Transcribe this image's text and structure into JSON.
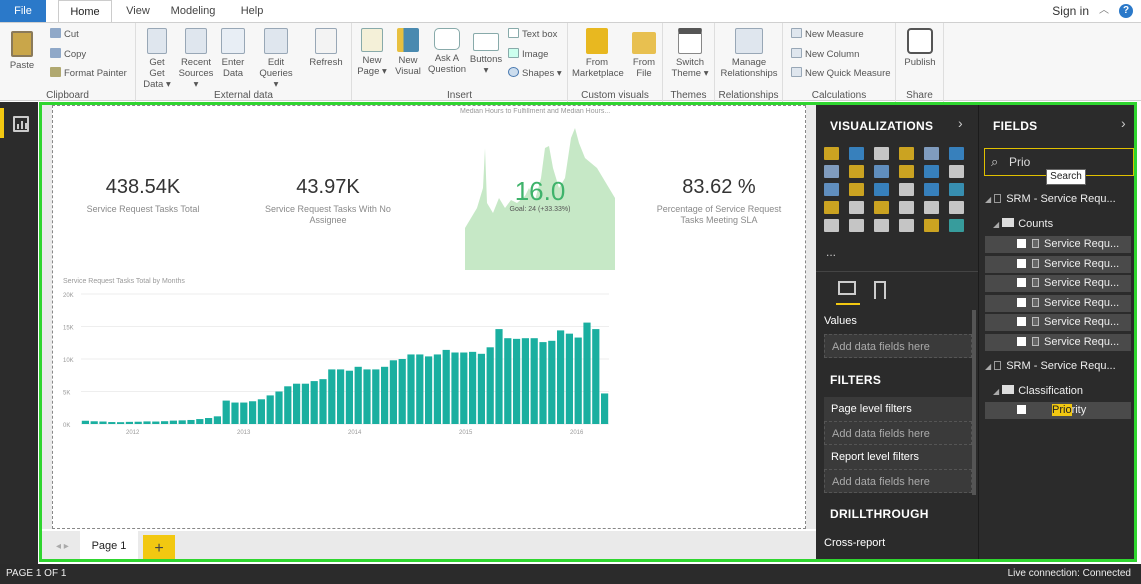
{
  "menubar": {
    "file": "File",
    "tabs": [
      "Home",
      "View",
      "Modeling",
      "Help"
    ],
    "signin": "Sign in",
    "help": "?"
  },
  "ribbon": {
    "clipboard": {
      "label": "Clipboard",
      "paste": "Paste",
      "cut": "Cut",
      "copy": "Copy",
      "format_painter": "Format Painter"
    },
    "external": {
      "label": "External data",
      "get_data": "Get Data ▾",
      "get_data_1": "Get",
      "recent_1": "Recent",
      "recent_2": "Sources ▾",
      "enter_1": "Enter",
      "enter_2": "Data",
      "edit_1": "Edit",
      "edit_2": "Queries ▾",
      "refresh": "Refresh"
    },
    "insert": {
      "label": "Insert",
      "new_page_1": "New",
      "new_page_2": "Page ▾",
      "new_visual_1": "New",
      "new_visual_2": "Visual",
      "ask_1": "Ask A",
      "ask_2": "Question",
      "buttons_1": "Buttons",
      "buttons_2": "▾",
      "text_box": "Text box",
      "image": "Image",
      "shapes": "Shapes ▾"
    },
    "custom_visuals": {
      "label": "Custom visuals",
      "from_marketplace_1": "From",
      "from_marketplace_2": "Marketplace",
      "from_file_1": "From",
      "from_file_2": "File"
    },
    "themes": {
      "label": "Themes",
      "switch_1": "Switch",
      "switch_2": "Theme ▾"
    },
    "relationships": {
      "label": "Relationships",
      "manage_1": "Manage",
      "manage_2": "Relationships"
    },
    "calculations": {
      "label": "Calculations",
      "new_measure": "New Measure",
      "new_column": "New Column",
      "new_quick_measure": "New Quick Measure"
    },
    "share": {
      "label": "Share",
      "publish": "Publish"
    }
  },
  "report": {
    "kpis": [
      {
        "value": "438.54K",
        "label": "Service Request Tasks Total"
      },
      {
        "value": "43.97K",
        "label": "Service Request Tasks With No Assignee"
      },
      {
        "value": "83.62 %",
        "label": "Percentage of Service Request Tasks Meeting SLA"
      }
    ],
    "gauge": {
      "title": "Median Hours to Fulfillment and Median Hours...",
      "value": "16.0",
      "goal": "Goal: 24 (+33.33%)"
    },
    "bar_chart_title": "Service Request Tasks Total by Months"
  },
  "chart_data": {
    "type": "bar",
    "title": "Service Request Tasks Total by Months",
    "xlabel": "",
    "ylabel": "",
    "ylim": [
      0,
      20000
    ],
    "yticks": [
      "20K",
      "15K",
      "10K",
      "5K",
      "0K"
    ],
    "xticks": [
      "2012",
      "2013",
      "2014",
      "2015",
      "2016"
    ],
    "color": "#1aafa0",
    "values": [
      500,
      420,
      380,
      300,
      280,
      330,
      350,
      400,
      380,
      430,
      520,
      560,
      620,
      760,
      920,
      1180,
      3600,
      3300,
      3300,
      3500,
      3800,
      4400,
      5000,
      5800,
      6200,
      6200,
      6600,
      6900,
      8400,
      8400,
      8200,
      8800,
      8400,
      8400,
      8800,
      9800,
      10000,
      10700,
      10700,
      10400,
      10700,
      11400,
      11000,
      11000,
      11100,
      10800,
      11800,
      14600,
      13200,
      13100,
      13200,
      13200,
      12600,
      12800,
      14400,
      13900,
      13300,
      15600,
      14600,
      4700
    ]
  },
  "pagetabs": {
    "page1": "Page 1",
    "add": "+"
  },
  "visualizations": {
    "title": "VISUALIZATIONS",
    "more": "...",
    "values_label": "Values",
    "values_well": "Add data fields here",
    "filters_title": "FILTERS",
    "page_level": "Page level filters",
    "page_well": "Add data fields here",
    "report_level": "Report level filters",
    "report_well": "Add data fields here",
    "drillthrough_title": "DRILLTHROUGH",
    "cross_report": "Cross-report"
  },
  "fields": {
    "title": "FIELDS",
    "search_value": "Prio",
    "search_tooltip": "Search",
    "table1": "SRM - Service Requ...",
    "folder1": "Counts",
    "items": [
      "Service Requ...",
      "Service Requ...",
      "Service Requ...",
      "Service Requ...",
      "Service Requ...",
      "Service Requ..."
    ],
    "table2": "SRM - Service Requ...",
    "folder2": "Classification",
    "priority_highlight": "Prio",
    "priority_rest": "rity"
  },
  "status": {
    "page": "PAGE 1 OF 1",
    "connection": "Live connection: Connected"
  }
}
